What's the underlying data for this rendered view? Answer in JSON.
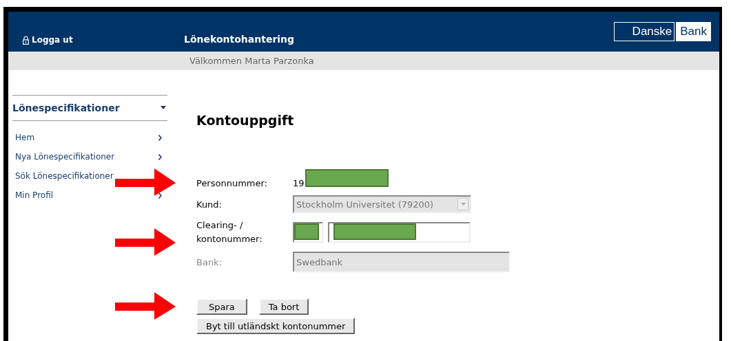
{
  "header": {
    "logout": "Logga ut",
    "title": "Lönekontohantering",
    "logo": [
      "Danske",
      "Bank"
    ]
  },
  "welcome": "Välkommen Marta Parzonka",
  "sidebar": {
    "title": "Lönespecifikationer",
    "expanded": true,
    "items": [
      {
        "label": "Hem"
      },
      {
        "label": "Nya Lönespecifikationer"
      },
      {
        "label": "Sök Lönespecifikationer"
      },
      {
        "label": "Min Profil"
      }
    ]
  },
  "form": {
    "heading": "Kontouppgift",
    "personnummer": {
      "label": "Personnummer:",
      "value": "19"
    },
    "kund": {
      "label": "Kund:",
      "value": "Stockholm Universitet (79200)",
      "disabled": true
    },
    "konto": {
      "label": "Clearing- / kontonummer:"
    },
    "bank": {
      "label": "Bank:",
      "value": "Swedbank",
      "disabled": true
    },
    "buttons": [
      {
        "label": "Spara"
      },
      {
        "label": "Ta bort"
      },
      {
        "label": "Byt till utländskt kontonummer"
      }
    ]
  }
}
